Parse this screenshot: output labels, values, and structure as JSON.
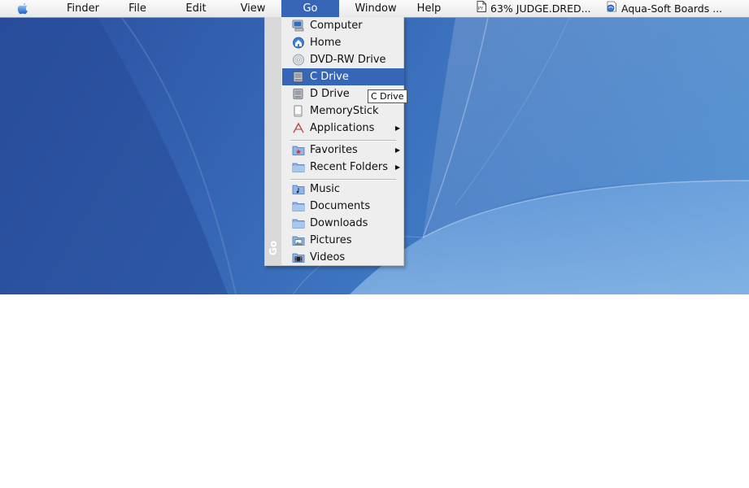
{
  "menubar": {
    "items": [
      {
        "label": "Finder"
      },
      {
        "label": "File"
      },
      {
        "label": "Edit"
      },
      {
        "label": "View"
      },
      {
        "label": "Go"
      },
      {
        "label": "Window"
      },
      {
        "label": "Help"
      }
    ],
    "tasks": [
      {
        "label": "63% JUDGE.DRED...",
        "icon": "document-icon"
      },
      {
        "label": "Aqua-Soft Boards ...",
        "icon": "browser-icon"
      }
    ]
  },
  "go_menu": {
    "side_label": "Go",
    "items": [
      {
        "label": "Computer",
        "icon": "computer-icon"
      },
      {
        "label": "Home",
        "icon": "home-icon"
      },
      {
        "label": "DVD-RW Drive",
        "icon": "dvd-icon"
      },
      {
        "label": "C Drive",
        "icon": "hard-drive-icon",
        "selected": true
      },
      {
        "label": "D Drive",
        "icon": "hard-drive-icon"
      },
      {
        "label": "MemoryStick",
        "icon": "removable-drive-icon"
      },
      {
        "label": "Applications",
        "icon": "applications-icon",
        "submenu": true
      },
      {
        "label": "Favorites",
        "icon": "favorites-folder-icon",
        "submenu": true
      },
      {
        "label": "Recent Folders",
        "icon": "folder-icon",
        "submenu": true
      },
      {
        "label": "Music",
        "icon": "music-folder-icon"
      },
      {
        "label": "Documents",
        "icon": "folder-icon"
      },
      {
        "label": "Downloads",
        "icon": "folder-icon"
      },
      {
        "label": "Pictures",
        "icon": "pictures-folder-icon"
      },
      {
        "label": "Videos",
        "icon": "videos-folder-icon"
      }
    ]
  },
  "tooltip": {
    "text": "C Drive"
  },
  "colors": {
    "highlight": "#3766b6",
    "desktop": "#3f78c2"
  }
}
